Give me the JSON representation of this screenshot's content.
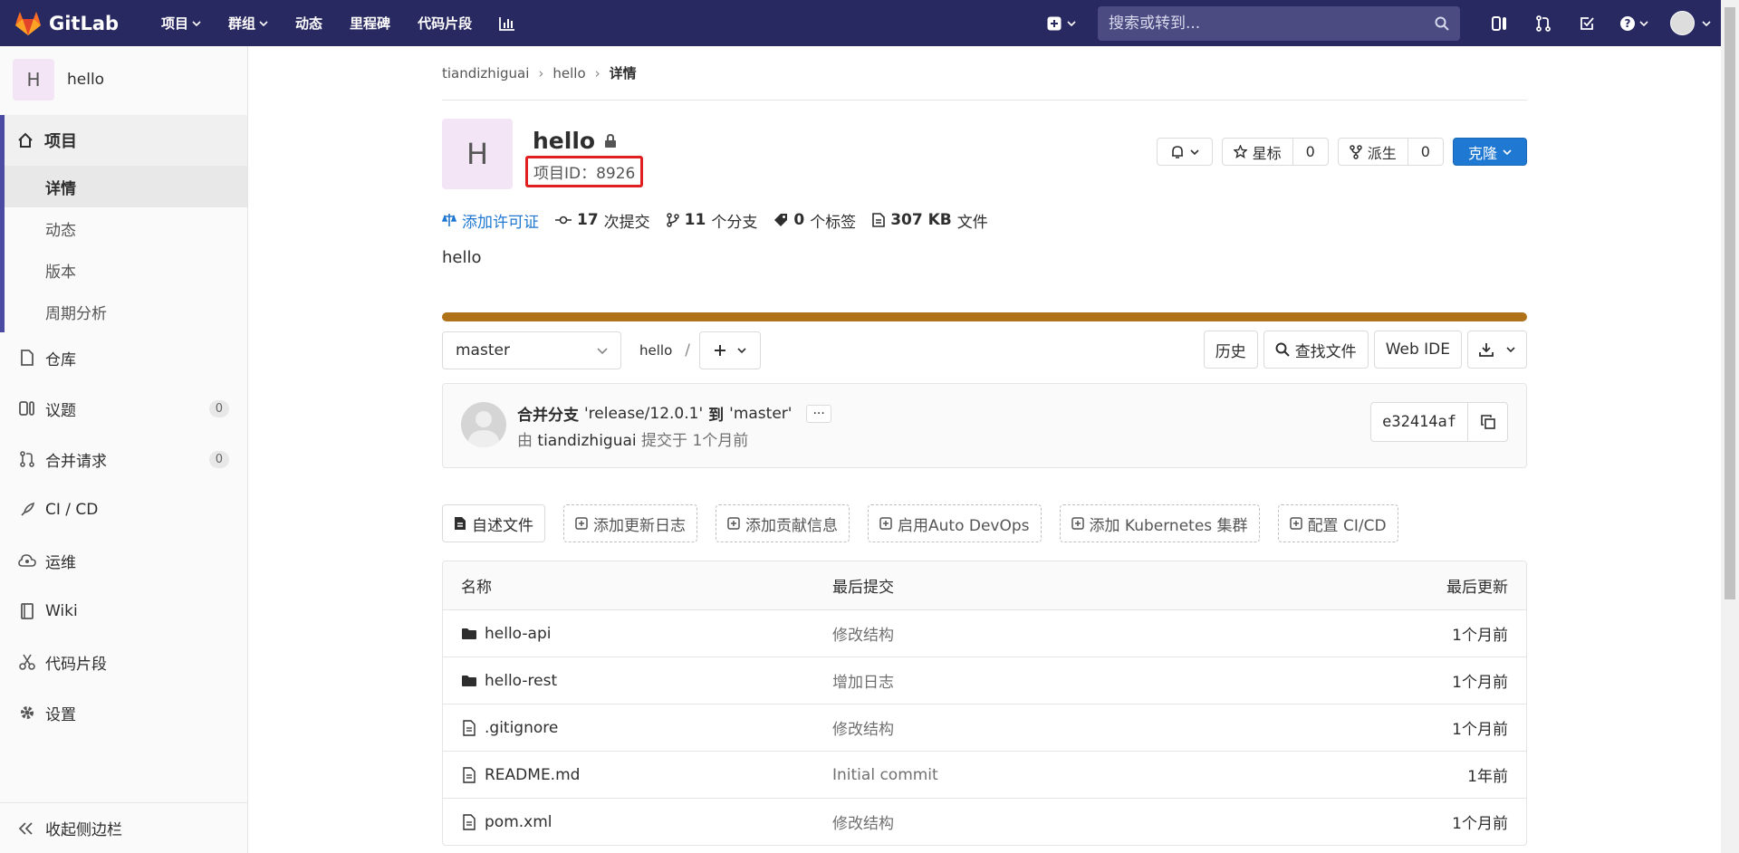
{
  "topbar": {
    "brand": "GitLab",
    "nav": [
      {
        "label": "项目",
        "dropdown": true
      },
      {
        "label": "群组",
        "dropdown": true
      },
      {
        "label": "动态",
        "dropdown": false
      },
      {
        "label": "里程碑",
        "dropdown": false
      },
      {
        "label": "代码片段",
        "dropdown": false
      }
    ],
    "search_placeholder": "搜索或转到...",
    "bg_color": "#292961"
  },
  "sidebar": {
    "project_initial": "H",
    "project_name": "hello",
    "active_section": "项目",
    "sub_items": [
      "详情",
      "动态",
      "版本",
      "周期分析"
    ],
    "items": [
      {
        "label": "仓库",
        "icon": "doc-icon"
      },
      {
        "label": "议题",
        "icon": "issues-icon",
        "badge": "0"
      },
      {
        "label": "合并请求",
        "icon": "merge-request-icon",
        "badge": "0"
      },
      {
        "label": "CI / CD",
        "icon": "rocket-icon"
      },
      {
        "label": "运维",
        "icon": "cloud-icon"
      },
      {
        "label": "Wiki",
        "icon": "book-icon"
      },
      {
        "label": "代码片段",
        "icon": "scissors-icon"
      },
      {
        "label": "设置",
        "icon": "gear-icon"
      }
    ],
    "collapse_label": "收起侧边栏"
  },
  "breadcrumb": {
    "items": [
      "tiandizhiguai",
      "hello"
    ],
    "current": "详情"
  },
  "project": {
    "initial": "H",
    "name": "hello",
    "id_label": "项目ID：8926",
    "star_label": "星标",
    "star_count": "0",
    "fork_label": "派生",
    "fork_count": "0",
    "clone_label": "克隆",
    "description": "hello"
  },
  "stats": {
    "license": "添加许可证",
    "commits_num": "17",
    "commits_label": "次提交",
    "branches_num": "11",
    "branches_label": "个分支",
    "tags_num": "0",
    "tags_label": "个标签",
    "size_num": "307 KB",
    "size_label": "文件"
  },
  "language_bar_color": "#b07219",
  "tree": {
    "branch": "master",
    "path": "hello",
    "path_sep": "/",
    "history": "历史",
    "find_file": "查找文件",
    "web_ide": "Web IDE"
  },
  "last_commit": {
    "title_prefix": "合并分支",
    "title_from": "'release/12.0.1'",
    "title_mid": "到",
    "title_to": "'master'",
    "ellipsis": "···",
    "by": "由",
    "author": "tiandizhiguai",
    "when": "提交于 1个月前",
    "sha": "e32414af"
  },
  "quick_buttons": [
    {
      "label": "自述文件",
      "solid": true,
      "icon": "readme-icon"
    },
    {
      "label": "添加更新日志",
      "solid": false,
      "icon": "plus-square-icon"
    },
    {
      "label": "添加贡献信息",
      "solid": false,
      "icon": "plus-square-icon"
    },
    {
      "label": "启用Auto DevOps",
      "solid": false,
      "icon": "plus-square-icon"
    },
    {
      "label": "添加 Kubernetes 集群",
      "solid": false,
      "icon": "plus-square-icon"
    },
    {
      "label": "配置 CI/CD",
      "solid": false,
      "icon": "plus-square-icon"
    }
  ],
  "file_table": {
    "headers": {
      "name": "名称",
      "commit": "最后提交",
      "date": "最后更新"
    },
    "rows": [
      {
        "name": "hello-api",
        "type": "folder",
        "commit": "修改结构",
        "date": "1个月前"
      },
      {
        "name": "hello-rest",
        "type": "folder",
        "commit": "增加日志",
        "date": "1个月前"
      },
      {
        "name": ".gitignore",
        "type": "file",
        "commit": "修改结构",
        "date": "1个月前"
      },
      {
        "name": "README.md",
        "type": "file",
        "commit": "Initial commit",
        "date": "1年前"
      },
      {
        "name": "pom.xml",
        "type": "file",
        "commit": "修改结构",
        "date": "1个月前"
      }
    ]
  }
}
